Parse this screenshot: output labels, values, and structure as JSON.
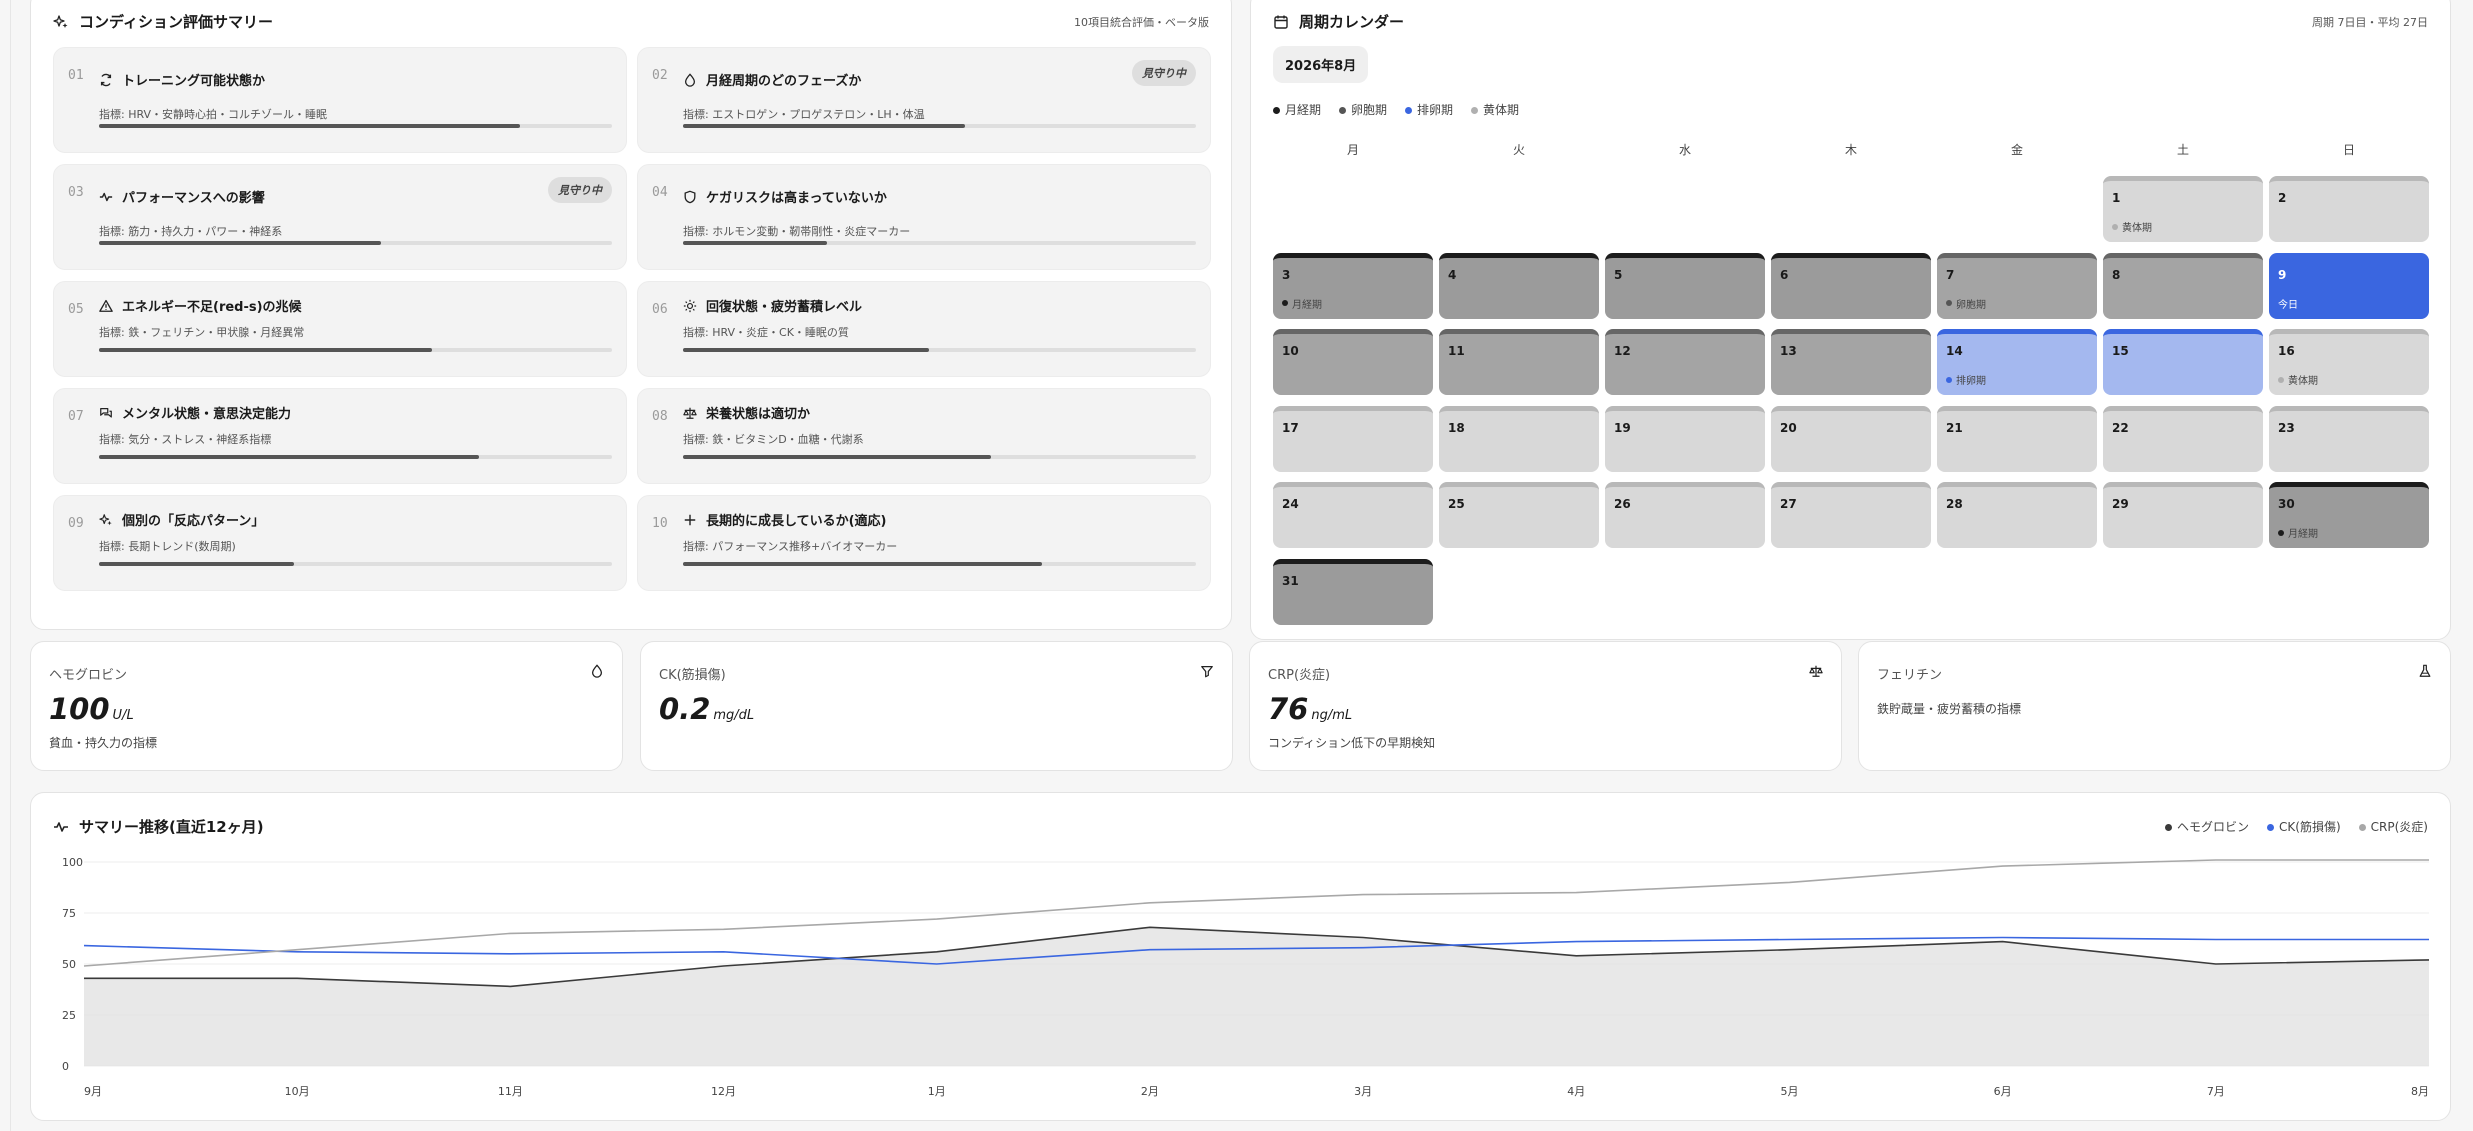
{
  "summary": {
    "title": "コンディション評価サマリー",
    "meta": "10項目統合評価・ベータ版",
    "items": [
      {
        "num": "01",
        "title": "トレーニング可能状態か",
        "indicator": "指標: HRV・安静時心拍・コルチゾール・睡眠",
        "badge": "",
        "level": 0.82,
        "icon": "refresh-icon"
      },
      {
        "num": "02",
        "title": "月経周期のどのフェーズか",
        "indicator": "指標: エストロゲン・プロゲステロン・LH・体温",
        "badge": "見守り中",
        "level": 0.55,
        "icon": "droplet-icon"
      },
      {
        "num": "03",
        "title": "パフォーマンスへの影響",
        "indicator": "指標: 筋力・持久力・パワー・神経系",
        "badge": "見守り中",
        "level": 0.55,
        "icon": "pulse-icon"
      },
      {
        "num": "04",
        "title": "ケガリスクは高まっていないか",
        "indicator": "指標: ホルモン変動・靭帯剛性・炎症マーカー",
        "badge": "",
        "level": 0.28,
        "icon": "shield-icon"
      },
      {
        "num": "05",
        "title": "エネルギー不足(red-s)の兆候",
        "indicator": "指標: 鉄・フェリチン・甲状腺・月経異常",
        "badge": "",
        "level": 0.65,
        "icon": "warning-icon"
      },
      {
        "num": "06",
        "title": "回復状態・疲労蓄積レベル",
        "indicator": "指標: HRV・炎症・CK・睡眠の質",
        "badge": "",
        "level": 0.48,
        "icon": "sun-icon"
      },
      {
        "num": "07",
        "title": "メンタル状態・意思決定能力",
        "indicator": "指標: 気分・ストレス・神経系指標",
        "badge": "",
        "level": 0.74,
        "icon": "chat-icon"
      },
      {
        "num": "08",
        "title": "栄養状態は適切か",
        "indicator": "指標: 鉄・ビタミンD・血糖・代謝系",
        "badge": "",
        "level": 0.6,
        "icon": "scale-icon"
      },
      {
        "num": "09",
        "title": "個別の「反応パターン」",
        "indicator": "指標: 長期トレンド(数周期)",
        "badge": "",
        "level": 0.38,
        "icon": "sparkle-icon"
      },
      {
        "num": "10",
        "title": "長期的に成長しているか(適応)",
        "indicator": "指標: パフォーマンス推移+バイオマーカー",
        "badge": "",
        "level": 0.7,
        "icon": "plus-icon"
      }
    ]
  },
  "calendar": {
    "title": "周期カレンダー",
    "meta": "周期 7日目・平均 27日",
    "month": "2026年8月",
    "legend": [
      {
        "label": "月経期",
        "color": "#1c1c1c"
      },
      {
        "label": "卵胞期",
        "color": "#555555"
      },
      {
        "label": "排卵期",
        "color": "#3a66e0"
      },
      {
        "label": "黄体期",
        "color": "#b0b0b0"
      }
    ],
    "weekdays": [
      "月",
      "火",
      "水",
      "木",
      "金",
      "土",
      "日"
    ],
    "first_col": 5,
    "days": [
      {
        "d": "1",
        "t": "none",
        "ph": "黄体期",
        "pc": "#b0b0b0"
      },
      {
        "d": "2",
        "t": "none",
        "ph": "",
        "pc": ""
      },
      {
        "d": "3",
        "t": "men",
        "ph": "月経期",
        "pc": "#1c1c1c"
      },
      {
        "d": "4",
        "t": "men",
        "ph": "",
        "pc": ""
      },
      {
        "d": "5",
        "t": "men",
        "ph": "",
        "pc": ""
      },
      {
        "d": "6",
        "t": "men",
        "ph": "",
        "pc": ""
      },
      {
        "d": "7",
        "t": "fol",
        "ph": "卵胞期",
        "pc": "#555555"
      },
      {
        "d": "8",
        "t": "fol",
        "ph": "",
        "pc": ""
      },
      {
        "d": "9",
        "t": "today",
        "ph": "今日",
        "pc": ""
      },
      {
        "d": "10",
        "t": "fol",
        "ph": "",
        "pc": ""
      },
      {
        "d": "11",
        "t": "fol",
        "ph": "",
        "pc": ""
      },
      {
        "d": "12",
        "t": "fol",
        "ph": "",
        "pc": ""
      },
      {
        "d": "13",
        "t": "fol",
        "ph": "",
        "pc": ""
      },
      {
        "d": "14",
        "t": "ovu",
        "ph": "排卵期",
        "pc": "#3a66e0"
      },
      {
        "d": "15",
        "t": "ovu",
        "ph": "",
        "pc": ""
      },
      {
        "d": "16",
        "t": "none",
        "ph": "黄体期",
        "pc": "#b0b0b0"
      },
      {
        "d": "17",
        "t": "none",
        "ph": "",
        "pc": ""
      },
      {
        "d": "18",
        "t": "none",
        "ph": "",
        "pc": ""
      },
      {
        "d": "19",
        "t": "none",
        "ph": "",
        "pc": ""
      },
      {
        "d": "20",
        "t": "none",
        "ph": "",
        "pc": ""
      },
      {
        "d": "21",
        "t": "none",
        "ph": "",
        "pc": ""
      },
      {
        "d": "22",
        "t": "none",
        "ph": "",
        "pc": ""
      },
      {
        "d": "23",
        "t": "none",
        "ph": "",
        "pc": ""
      },
      {
        "d": "24",
        "t": "none",
        "ph": "",
        "pc": ""
      },
      {
        "d": "25",
        "t": "none",
        "ph": "",
        "pc": ""
      },
      {
        "d": "26",
        "t": "none",
        "ph": "",
        "pc": ""
      },
      {
        "d": "27",
        "t": "none",
        "ph": "",
        "pc": ""
      },
      {
        "d": "28",
        "t": "none",
        "ph": "",
        "pc": ""
      },
      {
        "d": "29",
        "t": "none",
        "ph": "",
        "pc": ""
      },
      {
        "d": "30",
        "t": "men",
        "ph": "月経期",
        "pc": "#1c1c1c"
      },
      {
        "d": "31",
        "t": "men",
        "ph": "",
        "pc": ""
      }
    ]
  },
  "metrics": [
    {
      "label": "ヘモグロビン",
      "value": "100",
      "unit": "U/L",
      "desc": "貧血・持久力の指標",
      "icon": "droplet-icon"
    },
    {
      "label": "CK(筋損傷)",
      "value": "0.2",
      "unit": "mg/dL",
      "desc": "",
      "icon": "filter-icon"
    },
    {
      "label": "CRP(炎症)",
      "value": "76",
      "unit": "ng/mL",
      "desc": "コンディション低下の早期検知",
      "icon": "scale-icon"
    },
    {
      "label": "フェリチン",
      "value": "",
      "unit": "",
      "desc": "鉄貯蔵量・疲労蓄積の指標",
      "icon": "flask-icon"
    }
  ],
  "trend": {
    "title": "サマリー推移(直近12ヶ月)"
  },
  "chart_data": {
    "type": "line",
    "title": "サマリー推移(直近12ヶ月)",
    "x": [
      "9月",
      "10月",
      "11月",
      "12月",
      "1月",
      "2月",
      "3月",
      "4月",
      "5月",
      "6月",
      "7月",
      "8月"
    ],
    "ylim": [
      0,
      100
    ],
    "yticks": [
      0,
      25,
      50,
      75,
      100
    ],
    "grid": true,
    "legend": "top-right",
    "series": [
      {
        "name": "ヘモグロビン",
        "color": "#3a3a3a",
        "fill": true,
        "values": [
          43,
          43,
          39,
          49,
          56,
          68,
          63,
          54,
          57,
          61,
          50,
          52
        ]
      },
      {
        "name": "CK(筋損傷)",
        "color": "#3a66e0",
        "fill": false,
        "values": [
          59,
          56,
          55,
          56,
          50,
          57,
          58,
          61,
          62,
          63,
          62,
          62
        ]
      },
      {
        "name": "CRP(炎症)",
        "color": "#a8a8a8",
        "fill": false,
        "values": [
          49,
          57,
          65,
          67,
          72,
          80,
          84,
          85,
          90,
          98,
          101,
          101
        ]
      }
    ]
  }
}
